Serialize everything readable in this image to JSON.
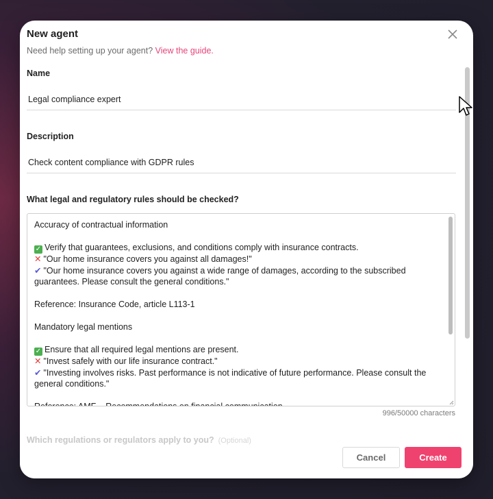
{
  "dialog": {
    "title": "New agent",
    "subtitle_prefix": "Need help setting up your agent? ",
    "subtitle_link": "View the guide."
  },
  "name_field": {
    "label": "Name",
    "value": "Legal compliance expert"
  },
  "description_field": {
    "label": "Description",
    "value": "Check content compliance with GDPR rules"
  },
  "rules_field": {
    "label": "What legal and regulatory rules should be checked?",
    "lines": [
      {
        "icon": "",
        "text": "Accuracy of contractual information"
      },
      {
        "icon": "",
        "text": ""
      },
      {
        "icon": "check-box",
        "text": "Verify that guarantees, exclusions, and conditions comply with insurance contracts."
      },
      {
        "icon": "cross-mark",
        "text": "\"Our home insurance covers you against all damages!\""
      },
      {
        "icon": "check-mark",
        "text": "\"Our home insurance covers you against a wide range of damages, according to the subscribed guarantees. Please consult the general conditions.\""
      },
      {
        "icon": "",
        "text": ""
      },
      {
        "icon": "",
        "text": "Reference: Insurance Code, article L113-1"
      },
      {
        "icon": "",
        "text": ""
      },
      {
        "icon": "",
        "text": "Mandatory legal mentions"
      },
      {
        "icon": "",
        "text": ""
      },
      {
        "icon": "check-box",
        "text": "Ensure that all required legal mentions are present."
      },
      {
        "icon": "cross-mark",
        "text": "\"Invest safely with our life insurance contract.\""
      },
      {
        "icon": "check-mark",
        "text": "\"Investing involves risks. Past performance is not indicative of future performance. Please consult the general conditions.\""
      },
      {
        "icon": "",
        "text": ""
      },
      {
        "icon": "",
        "text": "Reference: AMF – Recommendations on financial communication"
      }
    ],
    "counter": "996/50000 characters"
  },
  "regulators_field": {
    "label": "Which regulations or regulators apply to you?",
    "hint": "(Optional)"
  },
  "buttons": {
    "cancel": "Cancel",
    "create": "Create"
  },
  "colors": {
    "accent": "#f0426e",
    "link": "#e5457a"
  }
}
